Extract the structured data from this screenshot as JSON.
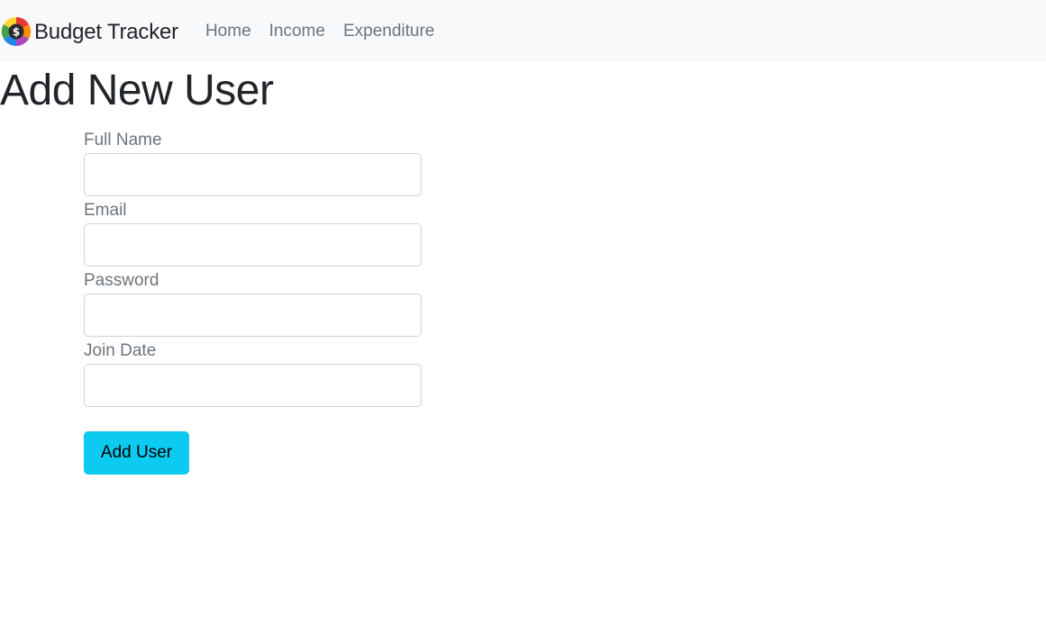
{
  "navbar": {
    "brand_label": "Budget Tracker",
    "brand_icon": "dollar-color-wheel-icon",
    "links": [
      {
        "label": "Home"
      },
      {
        "label": "Income"
      },
      {
        "label": "Expenditure"
      }
    ]
  },
  "page": {
    "title": "Add New User"
  },
  "form": {
    "full_name": {
      "label": "Full Name",
      "value": ""
    },
    "email": {
      "label": "Email",
      "value": ""
    },
    "password": {
      "label": "Password",
      "value": ""
    },
    "join_date": {
      "label": "Join Date",
      "value": ""
    },
    "submit_label": "Add User"
  },
  "colors": {
    "navbar_bg": "#f8f9fa",
    "button_bg": "#0dcaf0",
    "nav_link": "#6c757d",
    "text": "#212529"
  }
}
